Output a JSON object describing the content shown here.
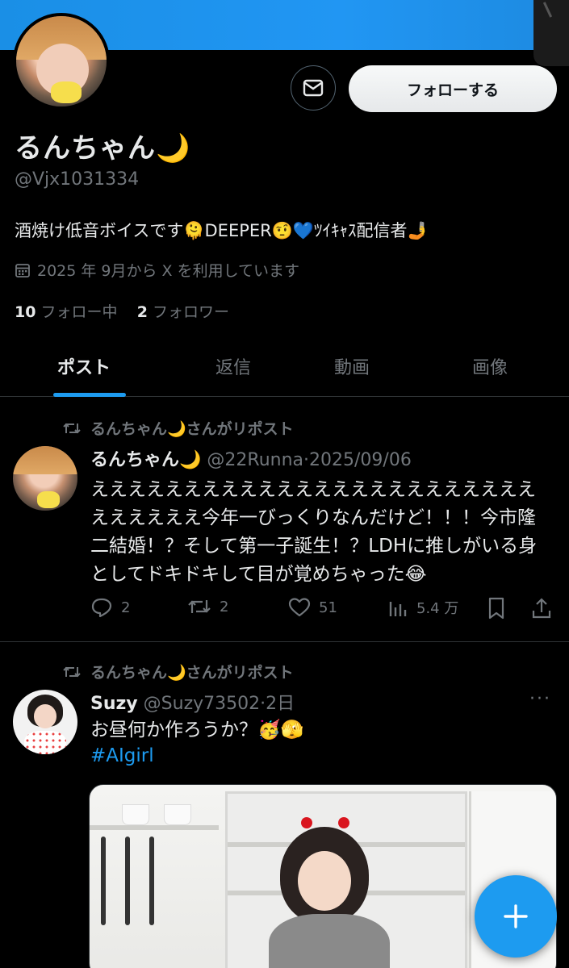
{
  "profile": {
    "display_name": "るんちゃん🌙",
    "handle": "@Vjx1031334",
    "bio": "酒焼け低音ボイスです🫠DEEPER🤨💙ﾂｲｷｬｽ配信者🤳",
    "joined": "2025 年 9月から X を利用しています",
    "following_count": "10",
    "following_label": "フォロー中",
    "followers_count": "2",
    "followers_label": "フォロワー",
    "follow_button": "フォローする",
    "message_icon": "envelope-icon"
  },
  "tabs": [
    {
      "label": "ポスト",
      "active": true
    },
    {
      "label": "返信",
      "active": false
    },
    {
      "label": "動画",
      "active": false
    },
    {
      "label": "画像",
      "active": false
    }
  ],
  "posts": [
    {
      "repost_label": "るんちゃん🌙さんがリポスト",
      "author_name": "るんちゃん🌙",
      "author_handle": "@22Runna",
      "date": "2025/09/06",
      "text": "ええええええええええええええええええええええええええええええ今年一びっくりなんだけど！！！今市隆二結婚！？そして第一子誕生！？LDHに推しがいる身としてドキドキして目が覚めちゃった😂",
      "replies": "2",
      "reposts": "2",
      "likes": "51",
      "views": "5.4 万"
    },
    {
      "repost_label": "るんちゃん🌙さんがリポスト",
      "author_name": "Suzy",
      "author_handle": "@Suzy73502",
      "date": "2日",
      "text": "お昼何か作ろうか？🥳🫣",
      "hashtag": "#AIgirl",
      "more": "···"
    }
  ],
  "fab_icon": "plus-icon",
  "colors": {
    "accent": "#1d9bf0",
    "background": "#000000",
    "text": "#e7e9ea",
    "muted": "#71767b"
  }
}
